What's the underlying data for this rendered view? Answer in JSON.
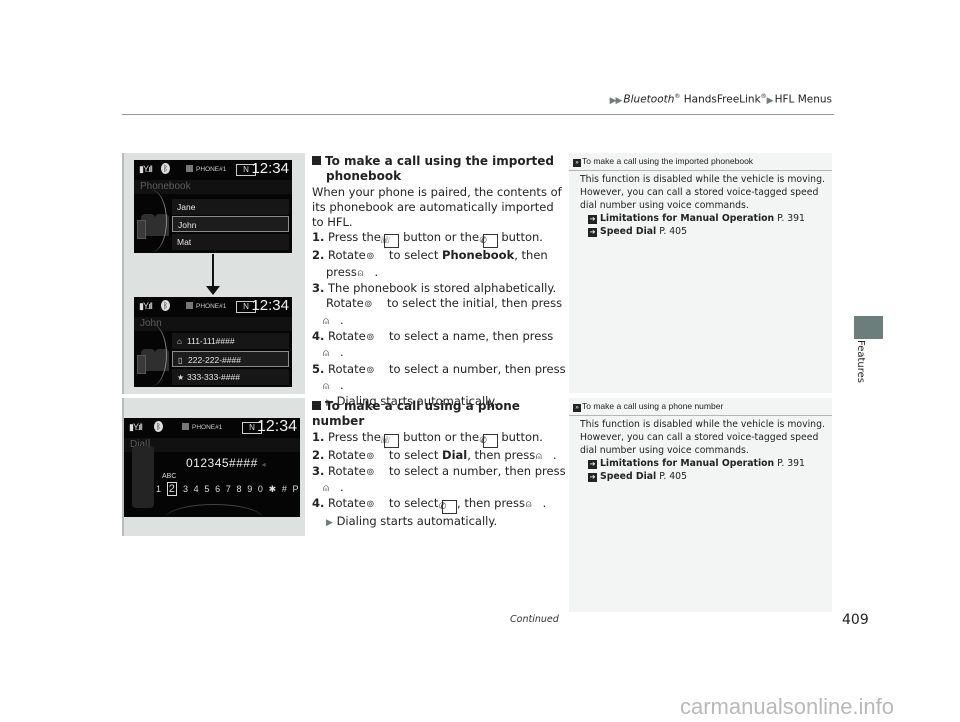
{
  "header": {
    "breadcrumb": [
      "Bluetooth",
      "HandsFreeLink",
      "HFL Menus"
    ],
    "registered_mark": "®"
  },
  "side_tab": {
    "label": "Features",
    "color": "#6c7e7b"
  },
  "screens": {
    "status": {
      "phone_label": "PHONE#1",
      "gear": "N",
      "time": "12:34"
    },
    "phonebook_screen": {
      "title": "Phonebook",
      "rows": [
        "Jane",
        "John",
        "Mat"
      ],
      "selected_index": 1
    },
    "contact_screen": {
      "title": "John",
      "rows": [
        {
          "icon": "home-icon",
          "glyph": "⌂",
          "number": "111-111####"
        },
        {
          "icon": "mobile-icon",
          "glyph": "▯",
          "number": "222-222-####"
        },
        {
          "icon": "star-icon",
          "glyph": "★",
          "number": "333-333-####"
        }
      ],
      "selected_index": 1
    },
    "dial_screen": {
      "title": "Dial",
      "number": "012345####",
      "key_letters": "ABC",
      "keys_before": "1",
      "selected_key": "2",
      "keys_after": "3 4 5 6 7 8 9 0 ✱ #  P",
      "trailing_icons": "⊠ ✆"
    }
  },
  "section1": {
    "heading_line1": "To make a call using the imported",
    "heading_line2": "phonebook",
    "intro": "When your phone is paired, the contents of its phonebook are automatically imported to HFL.",
    "steps": [
      {
        "n": "1.",
        "parts": [
          "Press the",
          "button or the",
          "button."
        ]
      },
      {
        "n": "2.",
        "parts": [
          "Rotate",
          "to select",
          "Phonebook",
          ", then press",
          "."
        ]
      },
      {
        "n": "3.",
        "parts": [
          "The phonebook is stored alphabetically. Rotate",
          "to select the initial, then press",
          "."
        ]
      },
      {
        "n": "4.",
        "parts": [
          "Rotate",
          "to select a name, then press",
          "."
        ]
      },
      {
        "n": "5.",
        "parts": [
          "Rotate",
          "to select a number, then press",
          "."
        ]
      }
    ],
    "result": "Dialing starts automatically."
  },
  "section2": {
    "heading": "To make a call using a phone number",
    "steps": [
      {
        "n": "1.",
        "parts": [
          "Press the",
          "button or the",
          "button."
        ]
      },
      {
        "n": "2.",
        "parts": [
          "Rotate",
          "to select",
          "Dial",
          ", then press",
          "."
        ]
      },
      {
        "n": "3.",
        "parts": [
          "Rotate",
          "to select a number, then press",
          "."
        ]
      },
      {
        "n": "4.",
        "parts": [
          "Rotate",
          "to select",
          ", then press",
          "."
        ]
      }
    ],
    "result": "Dialing starts automatically."
  },
  "notes": [
    {
      "title": "To make a call using the imported phonebook",
      "body": "This function is disabled while the vehicle is moving. However, you can call a stored voice-tagged speed dial number using voice commands.",
      "refs": [
        {
          "label": "Limitations for Manual Operation",
          "page": "P. 391"
        },
        {
          "label": "Speed Dial",
          "page": "P. 405"
        }
      ]
    },
    {
      "title": "To make a call using a phone number",
      "body": "This function is disabled while the vehicle is moving. However, you can call a stored voice-tagged speed dial number using voice commands.",
      "refs": [
        {
          "label": "Limitations for Manual Operation",
          "page": "P. 391"
        },
        {
          "label": "Speed Dial",
          "page": "P. 405"
        }
      ]
    }
  ],
  "footer": {
    "continued": "Continued",
    "page_number": "409"
  },
  "watermark": "carmanualsonline.info"
}
